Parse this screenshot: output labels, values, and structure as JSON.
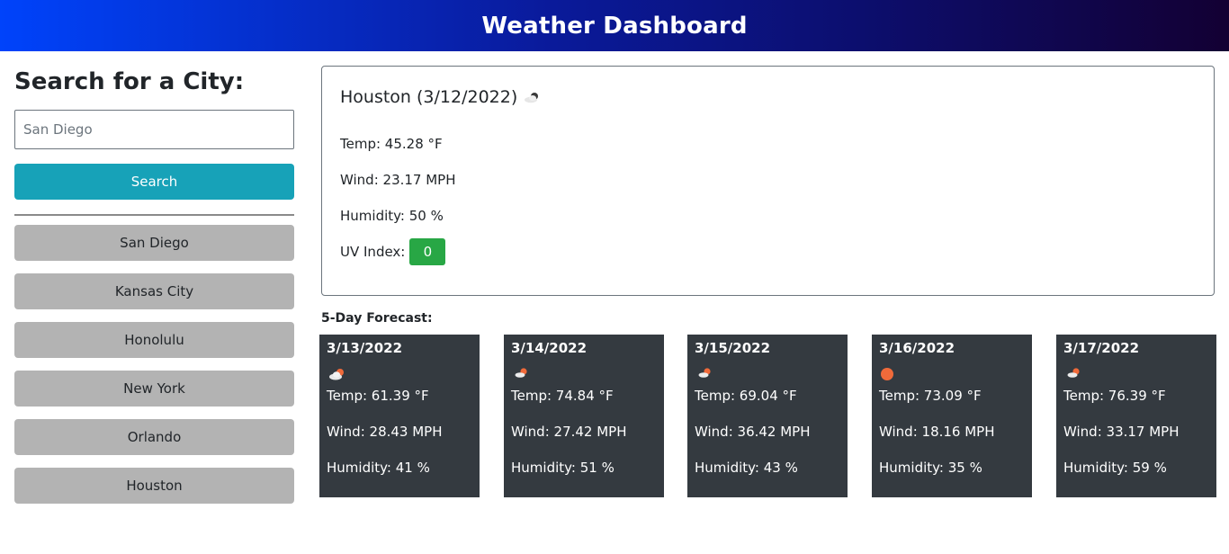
{
  "header": {
    "title": "Weather Dashboard"
  },
  "sidebar": {
    "heading": "Search for a City:",
    "search_value": "San Diego",
    "search_placeholder": "San Diego",
    "search_button": "Search",
    "history": [
      "San Diego",
      "Kansas City",
      "Honolulu",
      "New York",
      "Orlando",
      "Houston"
    ]
  },
  "current": {
    "title": "Houston (3/12/2022)",
    "icon": "partly-cloudy-night-icon",
    "temp": "Temp: 45.28 °F",
    "wind": "Wind: 23.17 MPH",
    "humidity": "Humidity: 50 %",
    "uv_label": "UV Index:",
    "uv_value": "0",
    "uv_color": "#28a745"
  },
  "forecast": {
    "label": "5-Day Forecast:",
    "days": [
      {
        "date": "3/13/2022",
        "icon": "broken-clouds-icon",
        "temp": "Temp: 61.39 °F",
        "wind": "Wind: 28.43 MPH",
        "humidity": "Humidity: 41 %"
      },
      {
        "date": "3/14/2022",
        "icon": "few-clouds-icon",
        "temp": "Temp: 74.84 °F",
        "wind": "Wind: 27.42 MPH",
        "humidity": "Humidity: 51 %"
      },
      {
        "date": "3/15/2022",
        "icon": "few-clouds-icon",
        "temp": "Temp: 69.04 °F",
        "wind": "Wind: 36.42 MPH",
        "humidity": "Humidity: 43 %"
      },
      {
        "date": "3/16/2022",
        "icon": "clear-sky-icon",
        "temp": "Temp: 73.09 °F",
        "wind": "Wind: 18.16 MPH",
        "humidity": "Humidity: 35 %"
      },
      {
        "date": "3/17/2022",
        "icon": "few-clouds-icon",
        "temp": "Temp: 76.39 °F",
        "wind": "Wind: 33.17 MPH",
        "humidity": "Humidity: 59 %"
      }
    ]
  },
  "colors": {
    "header_gradient_start": "#0043fb",
    "header_gradient_end": "#130033",
    "search_button": "#17a2b8",
    "history_button": "#b3b3b3",
    "forecast_card": "#343a40"
  }
}
